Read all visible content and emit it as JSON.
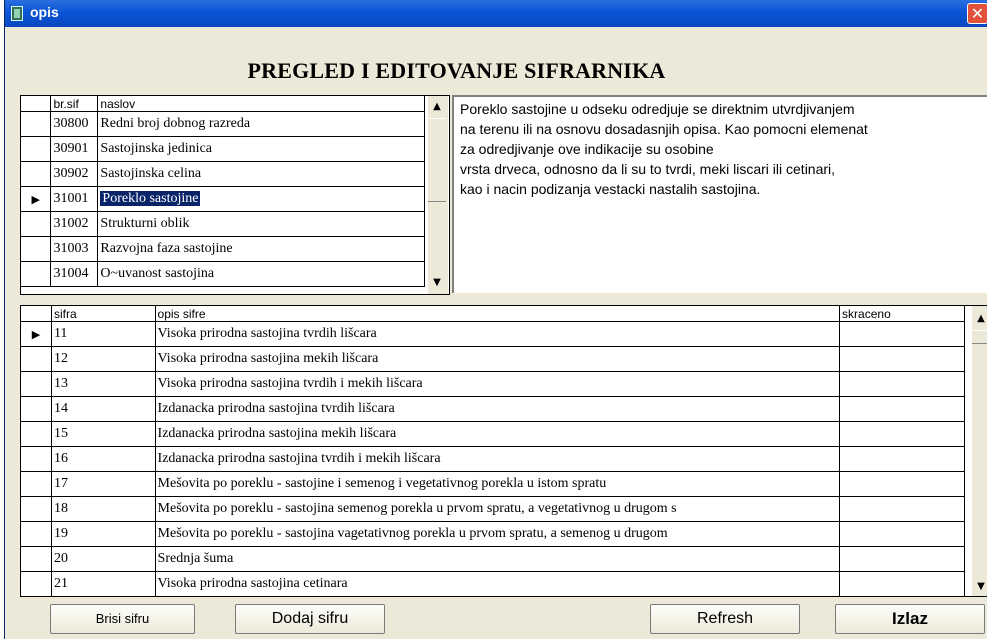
{
  "window": {
    "title": "opis",
    "close_glyph": "✕"
  },
  "heading": "PREGLED I EDITOVANJE SIFRARNIKA",
  "top_grid": {
    "headers": [
      "br.sif",
      "naslov"
    ],
    "rows": [
      {
        "code": "30800",
        "title": "Redni broj dobnog razreda"
      },
      {
        "code": "30901",
        "title": "Sastojinska jedinica"
      },
      {
        "code": "30902",
        "title": "Sastojinska celina"
      },
      {
        "code": "31001",
        "title": "Poreklo sastojine",
        "selected": true
      },
      {
        "code": "31002",
        "title": "Strukturni oblik"
      },
      {
        "code": "31003",
        "title": "Razvojna faza sastojine"
      },
      {
        "code": "31004",
        "title": "O~uvanost sastojina"
      }
    ]
  },
  "description": [
    "Poreklo  sastojine u odseku  odredjuje  se  direktnim utvrdjivanjem",
    "na terenu ili na osnovu dosadasnjih opisa.  Kao pomocni  elemenat",
    "za odredjivanje ove indikacije  su  osobine",
    "vrsta  drveca,  odnosno da li su to tvrdi,  meki  liscari  ili cetinari,",
    "kao i nacin podizanja vestacki nastalih sastojina."
  ],
  "bottom_grid": {
    "headers": [
      "sifra",
      "opis sifre",
      "skraceno"
    ],
    "rows": [
      {
        "code": "11",
        "desc": "Visoka prirodna sastojina tvrdih lišcara",
        "short": ""
      },
      {
        "code": "12",
        "desc": "Visoka prirodna sastojina mekih lišcara",
        "short": ""
      },
      {
        "code": "13",
        "desc": "Visoka prirodna sastojina tvrdih i mekih lišcara",
        "short": ""
      },
      {
        "code": "14",
        "desc": "Izdanacka prirodna sastojina tvrdih lišcara",
        "short": ""
      },
      {
        "code": "15",
        "desc": "Izdanacka prirodna sastojina mekih lišcara",
        "short": ""
      },
      {
        "code": "16",
        "desc": "Izdanacka prirodna sastojina tvrdih i mekih lišcara",
        "short": ""
      },
      {
        "code": "17",
        "desc": "Mešovita po poreklu - sastojine i semenog i vegetativnog porekla u istom spratu",
        "short": ""
      },
      {
        "code": "18",
        "desc": "Mešovita po poreklu - sastojina semenog porekla u prvom spratu, a vegetativnog u drugom s",
        "short": ""
      },
      {
        "code": "19",
        "desc": "Mešovita po poreklu - sastojina vagetativnog porekla u prvom spratu, a semenog u drugom",
        "short": ""
      },
      {
        "code": "20",
        "desc": "Srednja šuma",
        "short": ""
      },
      {
        "code": "21",
        "desc": "Visoka prirodna sastojina cetinara",
        "short": ""
      }
    ]
  },
  "buttons": {
    "delete": "Brisi sifru",
    "add": "Dodaj sifru",
    "refresh": "Refresh",
    "exit": "Izlaz"
  },
  "icons": {
    "row_indicator": "▶",
    "scroll_up": "▲",
    "scroll_down": "▼"
  }
}
